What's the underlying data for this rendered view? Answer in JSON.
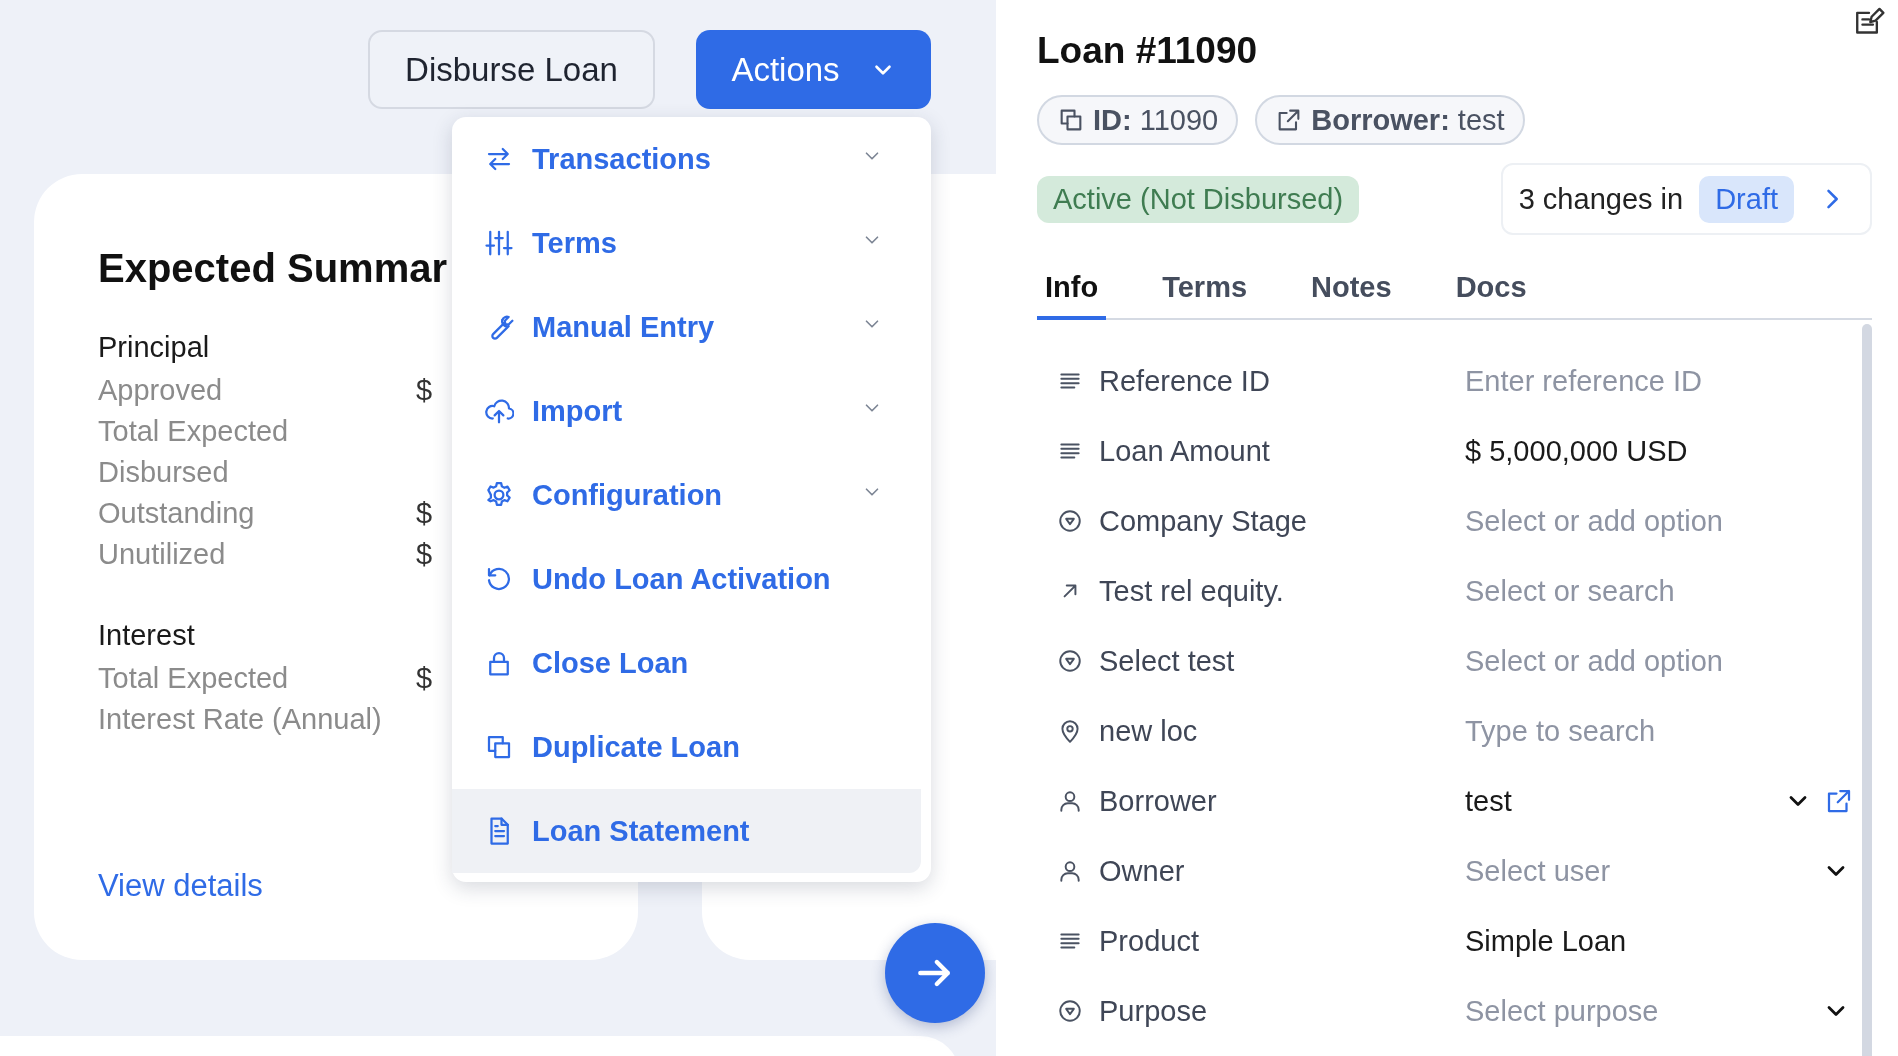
{
  "header_actions": {
    "disburse_button": "Disburse Loan",
    "actions_button": "Actions"
  },
  "actions_menu": [
    {
      "label": "Transactions",
      "has_submenu": true,
      "selected": false
    },
    {
      "label": "Terms",
      "has_submenu": true,
      "selected": false
    },
    {
      "label": "Manual Entry",
      "has_submenu": true,
      "selected": false
    },
    {
      "label": "Import",
      "has_submenu": true,
      "selected": false
    },
    {
      "label": "Configuration",
      "has_submenu": true,
      "selected": false
    },
    {
      "label": "Undo Loan Activation",
      "has_submenu": false,
      "selected": false
    },
    {
      "label": "Close Loan",
      "has_submenu": false,
      "selected": false
    },
    {
      "label": "Duplicate Loan",
      "has_submenu": false,
      "selected": false
    },
    {
      "label": "Loan Statement",
      "has_submenu": false,
      "selected": true
    }
  ],
  "summary_card": {
    "title": "Expected Summar",
    "sections": [
      {
        "heading": "Principal",
        "rows": [
          {
            "label": "Approved",
            "value": "$"
          },
          {
            "label": "Total Expected"
          },
          {
            "label": "Disbursed"
          },
          {
            "label": "Outstanding",
            "value": "$"
          },
          {
            "label": "Unutilized",
            "value": "$"
          }
        ]
      },
      {
        "heading": "Interest",
        "rows": [
          {
            "label": "Total Expected",
            "value": "$"
          },
          {
            "label": "Interest Rate (Annual)"
          }
        ]
      }
    ],
    "link": "View details"
  },
  "loan_panel": {
    "title": "Loan #11090",
    "chips": [
      {
        "label": "ID:",
        "value": "11090"
      },
      {
        "label": "Borrower:",
        "value": "test"
      }
    ],
    "status": "Active (Not Disbursed)",
    "draft": {
      "text": "3 changes in",
      "badge": "Draft"
    },
    "tabs": [
      {
        "label": "Info",
        "selected": true
      },
      {
        "label": "Terms",
        "selected": false
      },
      {
        "label": "Notes",
        "selected": false
      },
      {
        "label": "Docs",
        "selected": false
      }
    ],
    "fields": [
      {
        "label": "Reference ID",
        "placeholder": "Enter reference ID",
        "dropdown": false,
        "link": false
      },
      {
        "label": "Loan Amount",
        "value": "$ 5,000,000 USD",
        "dropdown": false,
        "link": false
      },
      {
        "label": "Company Stage",
        "placeholder": "Select or add option",
        "dropdown": false,
        "link": false
      },
      {
        "label": "Test rel equity.",
        "placeholder": "Select or search",
        "dropdown": false,
        "link": false
      },
      {
        "label": "Select test",
        "placeholder": "Select or add option",
        "dropdown": false,
        "link": false
      },
      {
        "label": "new loc",
        "placeholder": "Type to search",
        "dropdown": false,
        "link": false
      },
      {
        "label": "Borrower",
        "value": "test",
        "dropdown": true,
        "link": true
      },
      {
        "label": "Owner",
        "placeholder": "Select user",
        "dropdown": true,
        "link": false
      },
      {
        "label": "Product",
        "value": "Simple Loan",
        "dropdown": false,
        "link": false
      },
      {
        "label": "Purpose",
        "placeholder": "Select purpose",
        "dropdown": true,
        "link": false
      }
    ]
  }
}
